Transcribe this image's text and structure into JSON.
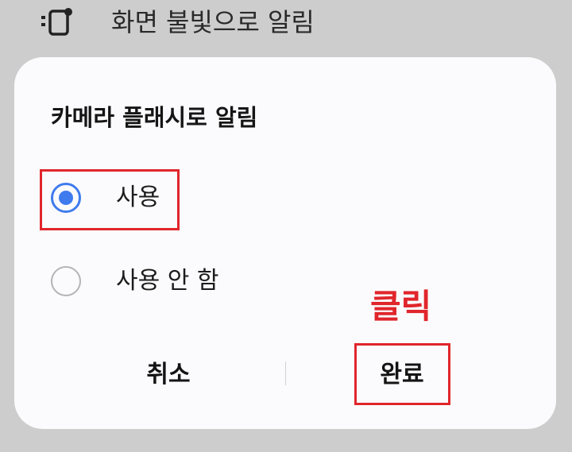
{
  "background_row": {
    "icon": "screen-flash-icon",
    "label": "화면 불빛으로 알림"
  },
  "dialog": {
    "title": "카메라 플래시로 알림",
    "options": [
      {
        "label": "사용",
        "checked": true
      },
      {
        "label": "사용 안 함",
        "checked": false
      }
    ],
    "buttons": {
      "cancel_label": "취소",
      "done_label": "완료"
    }
  },
  "annotation": {
    "click_label": "클릭",
    "color": "#e0262b"
  },
  "colors": {
    "accent": "#3f7bee",
    "dialog_background": "#fbfbfd",
    "page_background": "#cdcdcd"
  }
}
